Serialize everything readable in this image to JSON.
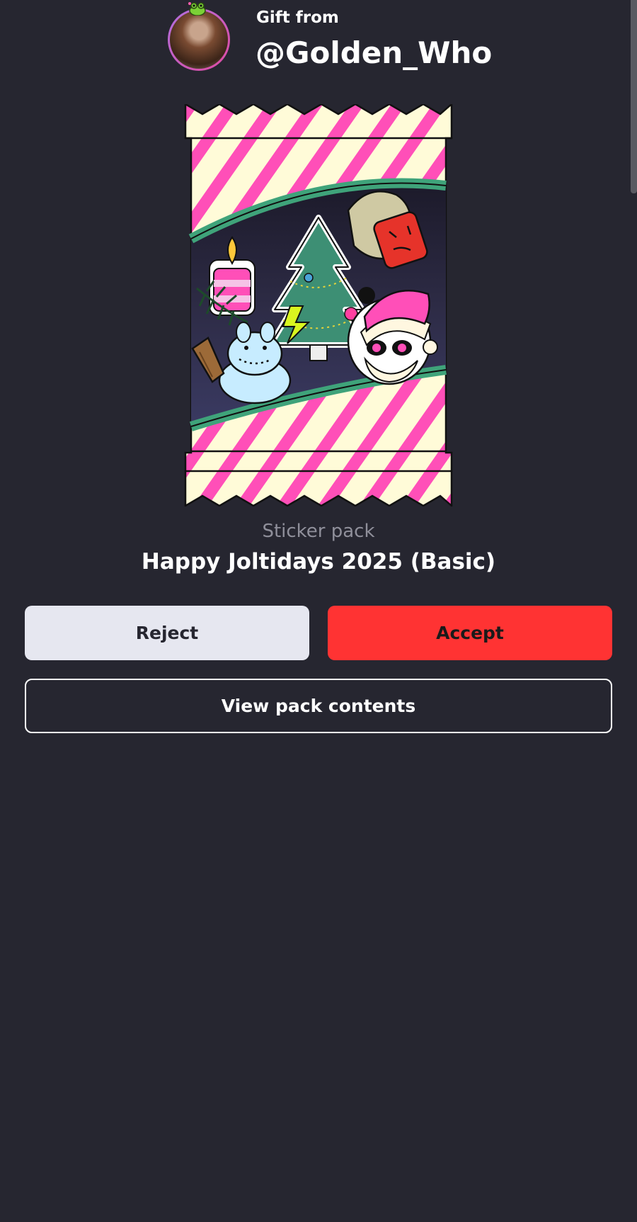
{
  "gift": {
    "from_label": "Gift from",
    "username": "@Golden_Who"
  },
  "pack": {
    "type_label": "Sticker pack",
    "name": "Happy Joltidays 2025 (Basic)",
    "stickers": [
      "candle-sticker",
      "christmas-tree-sticker",
      "santa-hat-face-sticker",
      "panda-santa-sticker",
      "snow-frog-sticker",
      "pine-branch-sticker",
      "wood-plank-sticker"
    ]
  },
  "actions": {
    "reject_label": "Reject",
    "accept_label": "Accept",
    "view_label": "View pack contents"
  },
  "colors": {
    "background": "#262630",
    "accept": "#ff3333",
    "reject": "#e6e7f0",
    "stripe": "#ff4fb8",
    "wrapper": "#fffbd8",
    "window_frame": "#3fa37a"
  }
}
